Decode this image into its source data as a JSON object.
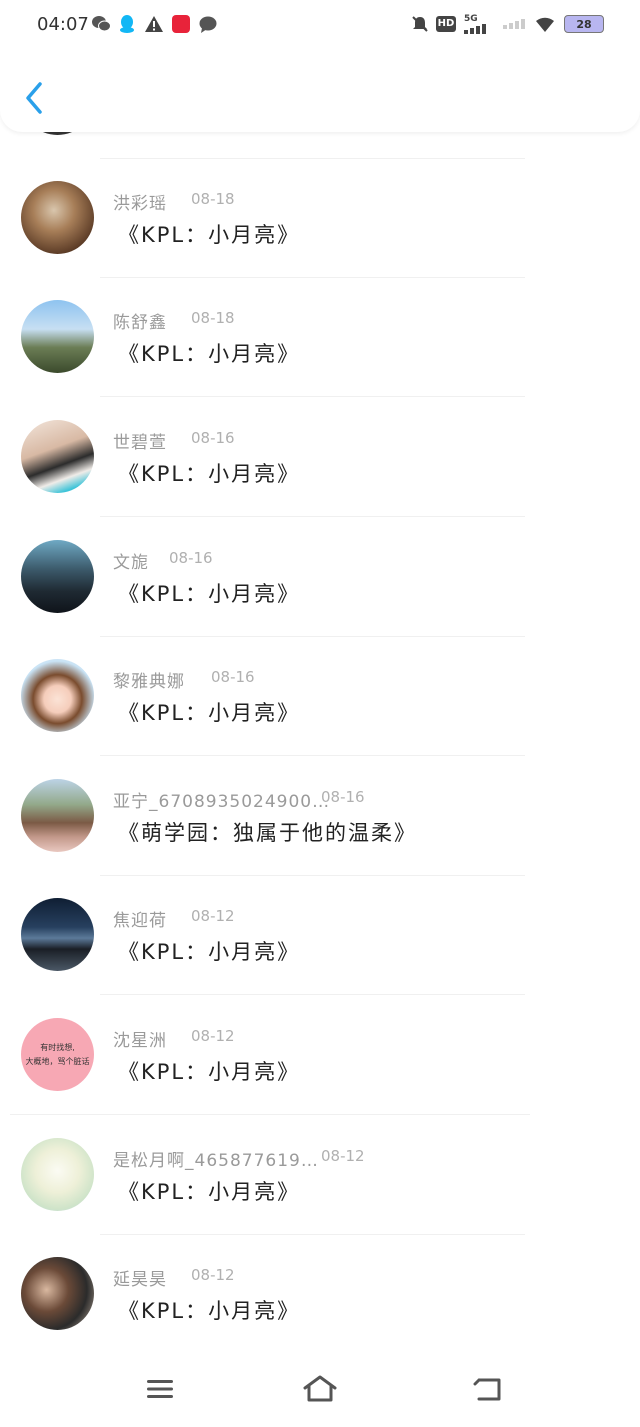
{
  "status_bar": {
    "time": "04:07",
    "network": "5G",
    "hd": "HD",
    "battery": "28"
  },
  "header": {
    "back_icon": "chevron-left-icon",
    "accent_color": "#2aa0ea"
  },
  "list": [
    {
      "name": "洪彩瑶",
      "date": "08-18",
      "content": "《KPL：小月亮》"
    },
    {
      "name": "陈舒鑫",
      "date": "08-18",
      "content": "《KPL：小月亮》"
    },
    {
      "name": "世碧萱",
      "date": "08-16",
      "content": "《KPL：小月亮》"
    },
    {
      "name": "文旎",
      "date": "08-16",
      "content": "《KPL：小月亮》"
    },
    {
      "name": "黎雅典娜",
      "date": "08-16",
      "content": "《KPL：小月亮》"
    },
    {
      "name": "亚宁_6708935024900…",
      "date": "08-16",
      "content": "《萌学园：独属于他的温柔》"
    },
    {
      "name": "焦迎荷",
      "date": "08-12",
      "content": "《KPL：小月亮》"
    },
    {
      "name": "沈星洲",
      "date": "08-12",
      "content": "《KPL：小月亮》",
      "avatar_text": [
        "有时找想,",
        "大概地，骂个脏话"
      ]
    },
    {
      "name": "是松月啊_465877619…",
      "date": "08-12",
      "content": "《KPL：小月亮》"
    },
    {
      "name": "延昊昊",
      "date": "08-12",
      "content": "《KPL：小月亮》"
    }
  ],
  "navbar": {
    "menu_icon": "menu-icon",
    "home_icon": "home-icon",
    "back_icon": "back-icon"
  }
}
